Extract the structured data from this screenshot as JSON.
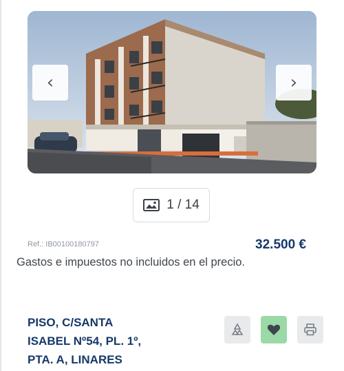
{
  "gallery": {
    "photo": "building-photo",
    "prev_icon": "chevron-left-icon",
    "next_icon": "chevron-right-icon",
    "counter": "1 / 14",
    "counter_icon": "image-icon"
  },
  "listing": {
    "ref": "Ref.: IB00100180797",
    "price": "32.500 €",
    "price_note": "Gastos e impuestos no incluidos en el precio.",
    "title_lines": [
      "PISO, C/SANTA",
      "ISABEL Nº54, PL. 1º,",
      "PTA. A, LINARES"
    ]
  },
  "actions": {
    "share_icon": "recycle-share-icon",
    "favorite_icon": "heart-icon",
    "print_icon": "printer-icon"
  },
  "colors": {
    "title": "#16386a",
    "favorite_bg": "#9bd9a6",
    "action_bg": "#e8eaec"
  }
}
